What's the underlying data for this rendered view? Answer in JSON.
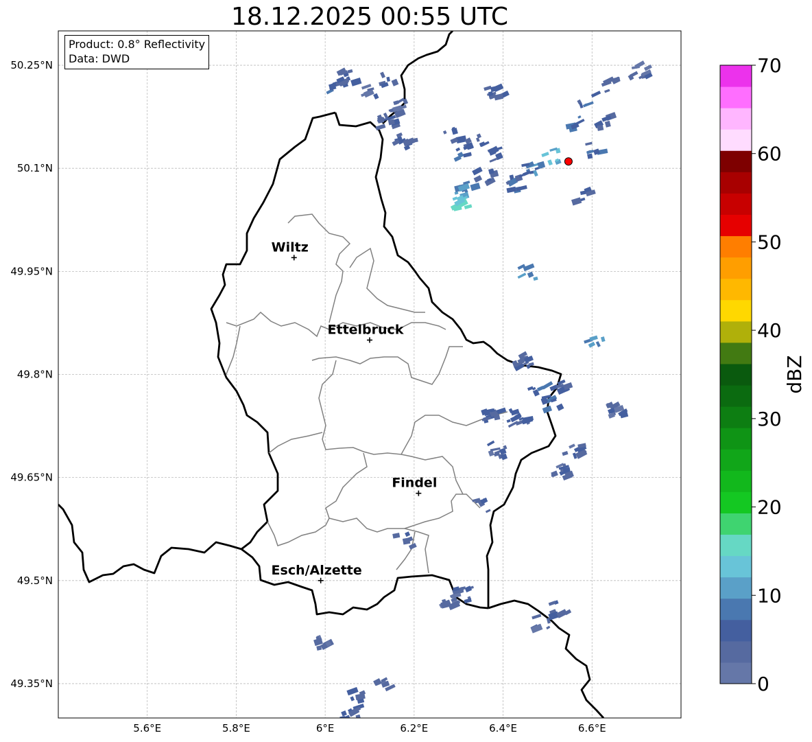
{
  "map": {
    "title": "18.12.2025 00:55 UTC",
    "info_box": {
      "product": "Product: 0.8° Reflectivity",
      "data_source": "Data: DWD"
    },
    "extent": {
      "lon_min": 5.4,
      "lon_max": 6.8,
      "lat_min": 49.3,
      "lat_max": 50.3
    },
    "gridlines": true,
    "lon_ticks": [
      {
        "value": 5.6,
        "label": "5.6°E"
      },
      {
        "value": 5.8,
        "label": "5.8°E"
      },
      {
        "value": 6.0,
        "label": "6°E"
      },
      {
        "value": 6.2,
        "label": "6.2°E"
      },
      {
        "value": 6.4,
        "label": "6.4°E"
      },
      {
        "value": 6.6,
        "label": "6.6°E"
      }
    ],
    "lat_ticks": [
      {
        "value": 50.25,
        "label": "50.25°N"
      },
      {
        "value": 50.1,
        "label": "50.1°N"
      },
      {
        "value": 49.95,
        "label": "49.95°N"
      },
      {
        "value": 49.8,
        "label": "49.8°N"
      },
      {
        "value": 49.65,
        "label": "49.65°N"
      },
      {
        "value": 49.5,
        "label": "49.5°N"
      },
      {
        "value": 49.35,
        "label": "49.35°N"
      }
    ],
    "cities": [
      {
        "name": "Wiltz",
        "lon": 5.93,
        "lat": 49.97
      },
      {
        "name": "Ettelbruck",
        "lon": 6.1,
        "lat": 49.85
      },
      {
        "name": "Findel",
        "lon": 6.21,
        "lat": 49.627
      },
      {
        "name": "Esch/Alzette",
        "lon": 5.99,
        "lat": 49.5
      }
    ],
    "radar_site": {
      "lon": 6.547,
      "lat": 50.11,
      "color": "#ff0000"
    },
    "border_color": "#000000",
    "canton_color": "#808080"
  },
  "colorbar": {
    "label": "dBZ",
    "min": 0,
    "max": 70,
    "ticks": [
      {
        "value": 0,
        "label": "0"
      },
      {
        "value": 10,
        "label": "10"
      },
      {
        "value": 20,
        "label": "20"
      },
      {
        "value": 30,
        "label": "30"
      },
      {
        "value": 40,
        "label": "40"
      },
      {
        "value": 50,
        "label": "50"
      },
      {
        "value": 60,
        "label": "60"
      },
      {
        "value": 70,
        "label": "70"
      }
    ],
    "colors": [
      "#6577a8",
      "#566aa0",
      "#445f9f",
      "#4a78b0",
      "#5aa0c8",
      "#68c4d8",
      "#66d8c4",
      "#3fd470",
      "#14c822",
      "#12b81c",
      "#11a619",
      "#0f9415",
      "#0d7e12",
      "#0b6b10",
      "#0a5a0e",
      "#427a12",
      "#b0b00a",
      "#ffd800",
      "#ffb800",
      "#ff9e00",
      "#ff7e00",
      "#e60000",
      "#c80000",
      "#a80000",
      "#7e0000",
      "#ffdcff",
      "#ffb6ff",
      "#ff6eff",
      "#ec32ec"
    ]
  },
  "radar_echoes": [
    {
      "lon": 6.02,
      "lat": 50.22,
      "dbz": 6
    },
    {
      "lon": 6.04,
      "lat": 50.235,
      "dbz": 5
    },
    {
      "lon": 6.1,
      "lat": 50.21,
      "dbz": 4
    },
    {
      "lon": 6.14,
      "lat": 50.23,
      "dbz": 5
    },
    {
      "lon": 6.13,
      "lat": 50.17,
      "dbz": 4
    },
    {
      "lon": 6.16,
      "lat": 50.19,
      "dbz": 3
    },
    {
      "lon": 6.17,
      "lat": 50.14,
      "dbz": 5
    },
    {
      "lon": 6.28,
      "lat": 50.15,
      "dbz": 6
    },
    {
      "lon": 6.3,
      "lat": 50.12,
      "dbz": 7
    },
    {
      "lon": 6.33,
      "lat": 50.14,
      "dbz": 5
    },
    {
      "lon": 6.31,
      "lat": 50.07,
      "dbz": 9
    },
    {
      "lon": 6.3,
      "lat": 50.05,
      "dbz": 14
    },
    {
      "lon": 6.35,
      "lat": 50.09,
      "dbz": 6
    },
    {
      "lon": 6.38,
      "lat": 50.12,
      "dbz": 5
    },
    {
      "lon": 6.37,
      "lat": 50.21,
      "dbz": 4
    },
    {
      "lon": 6.46,
      "lat": 50.1,
      "dbz": 8
    },
    {
      "lon": 6.5,
      "lat": 50.12,
      "dbz": 12
    },
    {
      "lon": 6.42,
      "lat": 50.08,
      "dbz": 6
    },
    {
      "lon": 6.55,
      "lat": 50.17,
      "dbz": 7
    },
    {
      "lon": 6.58,
      "lat": 50.2,
      "dbz": 6
    },
    {
      "lon": 6.62,
      "lat": 50.17,
      "dbz": 5
    },
    {
      "lon": 6.64,
      "lat": 50.22,
      "dbz": 4
    },
    {
      "lon": 6.6,
      "lat": 50.13,
      "dbz": 6
    },
    {
      "lon": 6.57,
      "lat": 50.06,
      "dbz": 5
    },
    {
      "lon": 6.7,
      "lat": 50.24,
      "dbz": 3
    },
    {
      "lon": 6.45,
      "lat": 49.95,
      "dbz": 9
    },
    {
      "lon": 6.44,
      "lat": 49.82,
      "dbz": 5
    },
    {
      "lon": 6.47,
      "lat": 49.78,
      "dbz": 6
    },
    {
      "lon": 6.5,
      "lat": 49.76,
      "dbz": 7
    },
    {
      "lon": 6.52,
      "lat": 49.78,
      "dbz": 5
    },
    {
      "lon": 6.4,
      "lat": 49.74,
      "dbz": 6
    },
    {
      "lon": 6.43,
      "lat": 49.73,
      "dbz": 5
    },
    {
      "lon": 6.36,
      "lat": 49.74,
      "dbz": 5
    },
    {
      "lon": 6.38,
      "lat": 49.69,
      "dbz": 4
    },
    {
      "lon": 6.55,
      "lat": 49.69,
      "dbz": 4
    },
    {
      "lon": 6.52,
      "lat": 49.66,
      "dbz": 4
    },
    {
      "lon": 6.6,
      "lat": 49.85,
      "dbz": 10
    },
    {
      "lon": 6.65,
      "lat": 49.75,
      "dbz": 4
    },
    {
      "lon": 6.35,
      "lat": 49.61,
      "dbz": 4
    },
    {
      "lon": 6.3,
      "lat": 49.48,
      "dbz": 4
    },
    {
      "lon": 6.27,
      "lat": 49.47,
      "dbz": 3
    },
    {
      "lon": 6.52,
      "lat": 49.46,
      "dbz": 4
    },
    {
      "lon": 6.48,
      "lat": 49.44,
      "dbz": 3
    },
    {
      "lon": 5.98,
      "lat": 49.41,
      "dbz": 3
    },
    {
      "lon": 6.06,
      "lat": 49.33,
      "dbz": 4
    },
    {
      "lon": 6.05,
      "lat": 49.31,
      "dbz": 5
    },
    {
      "lon": 6.12,
      "lat": 49.35,
      "dbz": 3
    },
    {
      "lon": 6.17,
      "lat": 49.56,
      "dbz": 3
    }
  ]
}
